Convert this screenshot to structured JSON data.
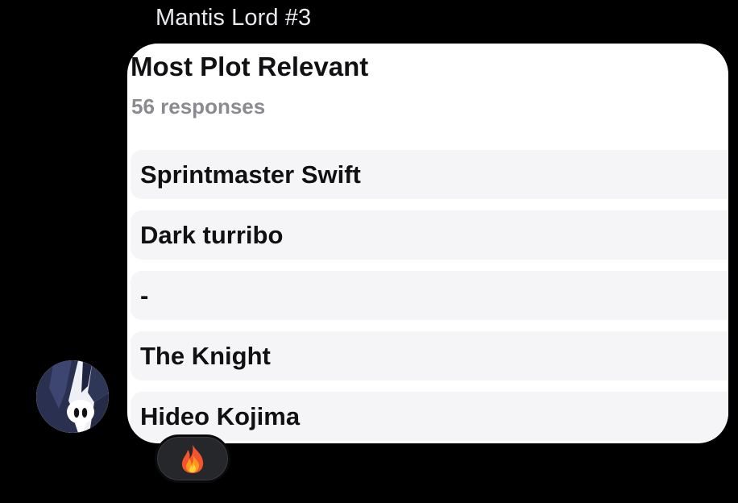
{
  "message": {
    "sender_name": "Mantis Lord #3",
    "avatar_icon": "hollow-knight-avatar-icon"
  },
  "poll": {
    "title": "Most Plot Relevant",
    "responses": "56 responses",
    "options": [
      {
        "label": "Sprintmaster Swift"
      },
      {
        "label": "Dark turribo"
      },
      {
        "label": "-"
      },
      {
        "label": "The Knight"
      },
      {
        "label": "Hideo Kojima"
      }
    ]
  },
  "reaction": {
    "icon": "fire-emoji-icon"
  },
  "colors": {
    "background": "#000000",
    "bubble": "#ffffff",
    "option_bg": "#f5f5f8",
    "muted_text": "#8a8a90",
    "reaction_bg": "#26272b"
  }
}
